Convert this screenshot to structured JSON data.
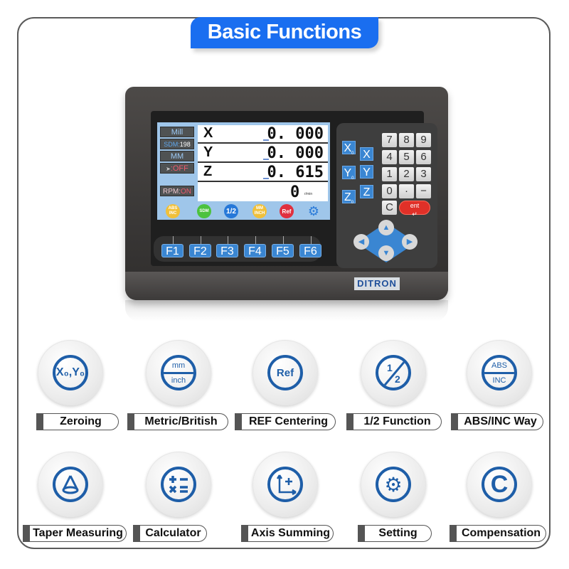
{
  "header": {
    "title": "Basic Functions"
  },
  "device": {
    "brand": "DITRON",
    "lcd": {
      "side_tags": {
        "mode": "Mill",
        "sdm_label": "SDM:",
        "sdm_value": "198",
        "unit": "MM",
        "laser_suffix": ":OFF",
        "rpm_label": "RPM:",
        "rpm_state": "ON"
      },
      "axes": [
        {
          "axis": "X",
          "value": "0. 000"
        },
        {
          "axis": "Y",
          "value": "0. 000"
        },
        {
          "axis": "Z",
          "value": "0. 615"
        }
      ],
      "rpm_value": "0",
      "rpm_unit": "r/min",
      "softkeys": [
        {
          "label": "ABS INC",
          "color": "#f0c03a"
        },
        {
          "label": "SDM",
          "color": "#4cc23e"
        },
        {
          "label": "1/2",
          "color": "#2678d8"
        },
        {
          "label": "MM INCH",
          "color": "#f0c03a"
        },
        {
          "label": "Ref",
          "color": "#e0303e"
        },
        {
          "label": "gear-icon",
          "color": "#2a7ad8"
        }
      ]
    },
    "keypad": {
      "axis_zero_keys": [
        "X",
        "Y",
        "Z"
      ],
      "axis_zero_sub": "0",
      "axis_keys": [
        "X",
        "Y",
        "Z"
      ],
      "numeric": [
        "7",
        "8",
        "9",
        "4",
        "5",
        "6",
        "1",
        "2",
        "3",
        "0",
        "·",
        "−",
        "C"
      ],
      "enter": "ent",
      "arrows": [
        "▲",
        "◀",
        "▶",
        "▼"
      ]
    },
    "function_keys": [
      "F1",
      "F2",
      "F3",
      "F4",
      "F5",
      "F6"
    ]
  },
  "functions": [
    {
      "label": "Zeroing",
      "icon": "zeroing-icon",
      "icon_text": "X₀,Y₀"
    },
    {
      "label": "Metric/British",
      "icon": "metric-british-icon",
      "icon_top": "mm",
      "icon_bottom": "inch"
    },
    {
      "label": "REF Centering",
      "icon": "ref-icon",
      "icon_text": "Ref"
    },
    {
      "label": "1/2 Function",
      "icon": "half-icon",
      "icon_top": "1",
      "icon_bottom": "2"
    },
    {
      "label": "ABS/INC Way",
      "icon": "abs-inc-icon",
      "icon_top": "ABS",
      "icon_bottom": "INC"
    },
    {
      "label": "Taper Measuring",
      "icon": "cone-icon"
    },
    {
      "label": "Calculator",
      "icon": "calculator-icon",
      "icon_text": "+− ×="
    },
    {
      "label": "Axis Summing",
      "icon": "axis-summing-icon",
      "icon_text": "+"
    },
    {
      "label": "Setting",
      "icon": "gear-icon",
      "icon_text": "⚙"
    },
    {
      "label": "Compensation",
      "icon": "compensation-icon",
      "icon_text": "C"
    }
  ],
  "colors": {
    "accent": "#1a6ef0",
    "icon_blue": "#1e5ea8",
    "key_blue": "#3a86d2"
  }
}
